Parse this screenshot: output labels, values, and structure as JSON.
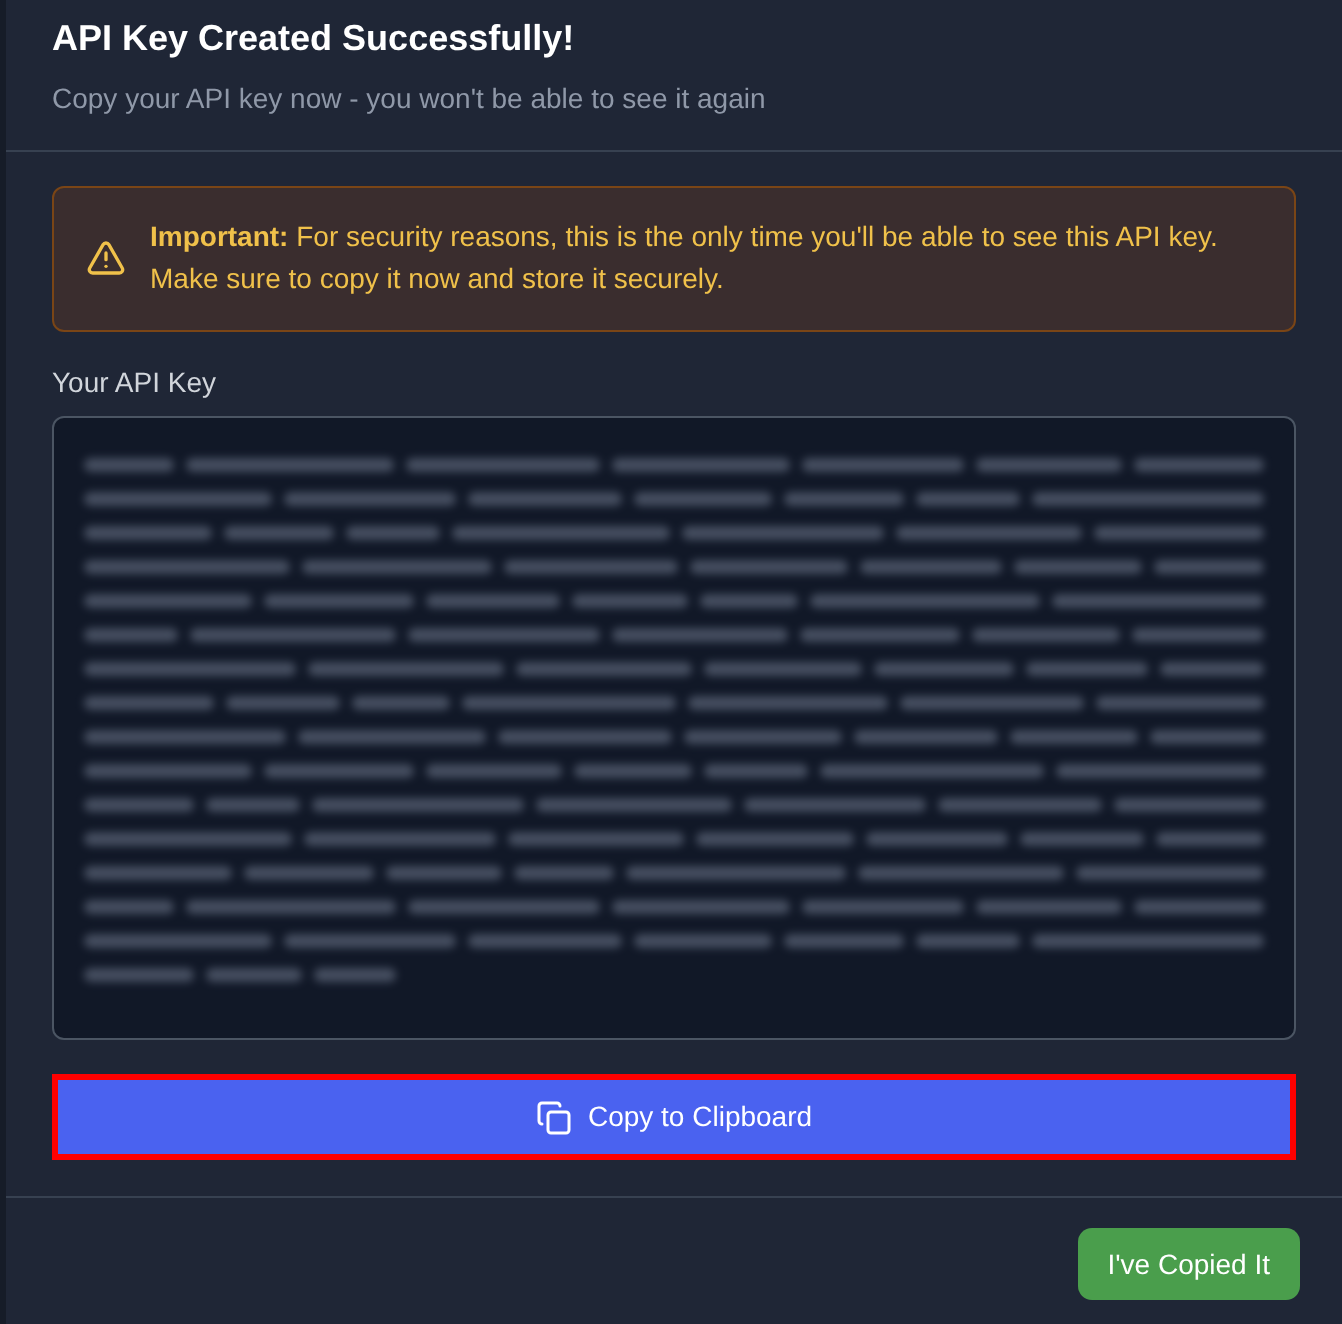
{
  "dialog": {
    "title": "API Key Created Successfully!",
    "subtitle": "Copy your API key now - you won't be able to see it again"
  },
  "warning": {
    "text": "**Important:** For security reasons, this is the only time you'll be able to see this API key. Make sure to copy it now and store it securely."
  },
  "api_key": {
    "label": "Your API Key",
    "obscured": true
  },
  "copy_button": {
    "label": "Copy to Clipboard",
    "highlighted": true
  },
  "footer": {
    "buttons": [
      {
        "label": "I've Copied It",
        "kind": "confirm"
      }
    ]
  }
}
